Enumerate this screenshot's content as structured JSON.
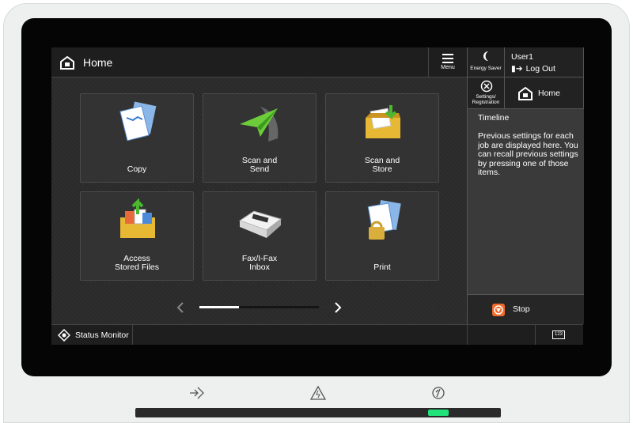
{
  "header": {
    "title": "Home",
    "menu_label": "Menu"
  },
  "tiles": [
    {
      "label": "Copy",
      "icon": "copy-icon"
    },
    {
      "label": "Scan and\nSend",
      "icon": "scan-send-icon"
    },
    {
      "label": "Scan and\nStore",
      "icon": "scan-store-icon"
    },
    {
      "label": "Access\nStored Files",
      "icon": "stored-files-icon"
    },
    {
      "label": "Fax/I-Fax\nInbox",
      "icon": "fax-inbox-icon"
    },
    {
      "label": "Print",
      "icon": "print-icon"
    }
  ],
  "pager": {
    "current_page": 1,
    "total_pages": 3
  },
  "right_panel": {
    "energy_saver": "Energy Saver",
    "user": "User1",
    "logout": "Log Out",
    "settings": "Settings/\nRegistration",
    "home": "Home",
    "timeline_title": "Timeline",
    "timeline_text": "Previous settings for each job are displayed here. You can recall previous settings by pressing one of those items.",
    "stop": "Stop",
    "keypad": "123"
  },
  "status_bar": {
    "status_monitor": "Status Monitor"
  },
  "colors": {
    "stop": "#f06a2a",
    "led": "#22e27a"
  }
}
